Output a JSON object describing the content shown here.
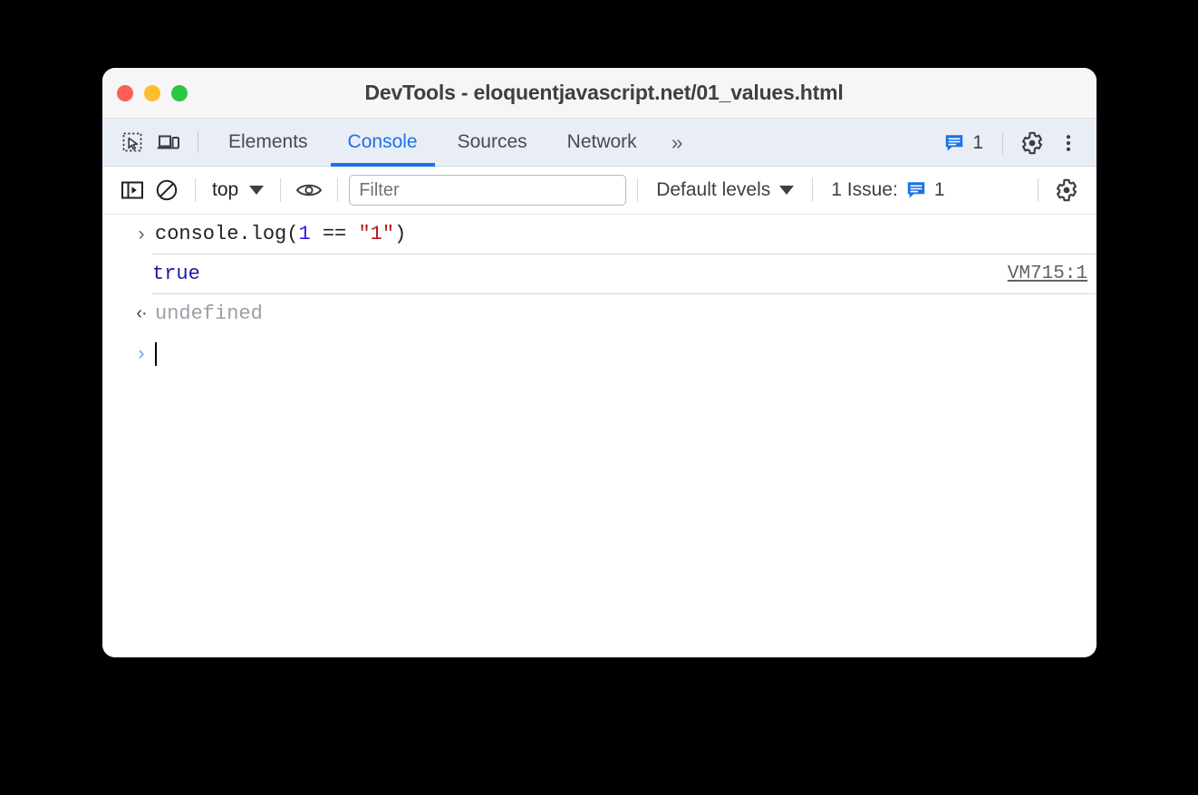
{
  "window": {
    "title": "DevTools - eloquentjavascript.net/01_values.html",
    "traffic_lights": [
      {
        "name": "close",
        "color": "#fd5f57"
      },
      {
        "name": "minimize",
        "color": "#febc2e"
      },
      {
        "name": "maximize",
        "color": "#28c840"
      }
    ]
  },
  "tabbar": {
    "inspect_icon": "inspect-element-icon",
    "device_icon": "device-toolbar-icon",
    "tabs": [
      {
        "label": "Elements",
        "active": false
      },
      {
        "label": "Console",
        "active": true
      },
      {
        "label": "Sources",
        "active": false
      },
      {
        "label": "Network",
        "active": false
      }
    ],
    "more_tabs": "»",
    "issues_icon": "issues-message-icon",
    "issues_count": "1",
    "settings_icon": "gear-icon",
    "menu_icon": "kebab-menu-icon"
  },
  "console_toolbar": {
    "sidebar_icon": "console-sidebar-icon",
    "clear_icon": "clear-console-icon",
    "context": "top",
    "context_caret": "▾",
    "eye_icon": "live-expression-eye-icon",
    "filter_placeholder": "Filter",
    "filter_value": "",
    "levels_label": "Default levels",
    "levels_caret": "▾",
    "issues_label": "1 Issue:",
    "issues_icon": "issues-message-icon",
    "issues_count": "1",
    "settings_icon": "console-settings-gear-icon"
  },
  "console_rows": [
    {
      "type": "input",
      "gutter": "›",
      "tokens": [
        {
          "text": "console.log(",
          "kind": "plain"
        },
        {
          "text": "1",
          "kind": "num"
        },
        {
          "text": " == ",
          "kind": "plain"
        },
        {
          "text": "\"1\"",
          "kind": "str"
        },
        {
          "text": ")",
          "kind": "plain"
        }
      ]
    },
    {
      "type": "output",
      "text": "true",
      "source": "VM715:1"
    },
    {
      "type": "result",
      "gutter": "‹·",
      "text": "undefined"
    },
    {
      "type": "prompt",
      "gutter": "›",
      "text": ""
    }
  ],
  "colors": {
    "accent_blue": "#1a73e8",
    "tabbar_bg": "#e9edf5",
    "titlebar_bg": "#f6f6f6",
    "output_blue": "#1a1aa6",
    "string_red": "#b51a1a",
    "number_blue": "#2b1ae0",
    "muted_gray": "#9aa0a6",
    "backdrop": "#000000"
  }
}
